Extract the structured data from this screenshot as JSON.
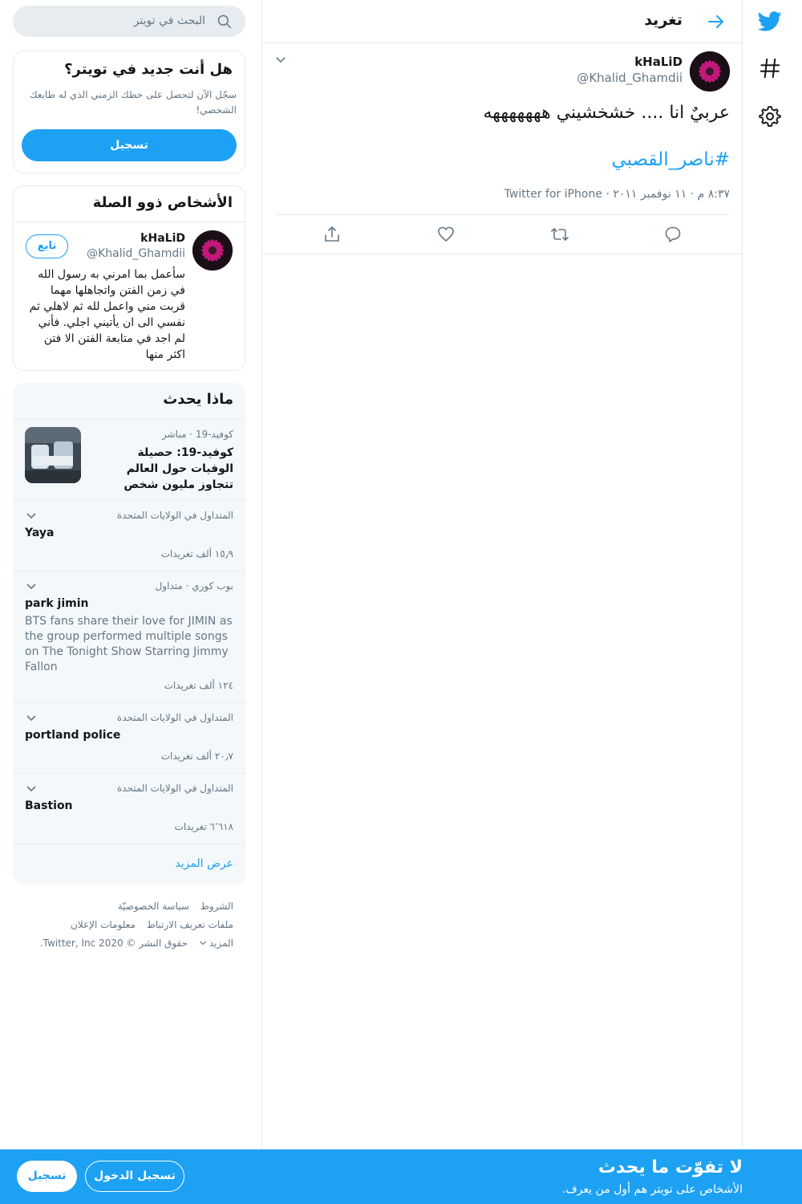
{
  "search": {
    "placeholder": "البحث في تويتر",
    "icon": "search-icon"
  },
  "new_to_twitter": {
    "title": "هل أنت جديد في تويتر؟",
    "description": "سجّل الآن لتحصل على خطك الزمني الذي له طابعك الشخصي!",
    "signup_label": "تسجيل"
  },
  "relevant_people": {
    "title": "الأشخاص ذوو الصلة",
    "user": {
      "name": "kHaLiD",
      "handle": "@Khalid_Ghamdii",
      "follow_label": "تابع",
      "bio": "سأعمل بما امرني به رسول الله في زمن الفتن واتجاهلها مهما قربت مني واعمل لله ثم لاهلي ثم نفسي الى ان يأتيني اجلي. فأني لم اجد في متابعة الفتن الا فتن اكثر منها"
    }
  },
  "trends": {
    "title": "ماذا يحدث",
    "news": {
      "meta": "كوفيد-19 · مباشر",
      "headline": "كوفيد-19: حصيلة الوفيات حول العالم تتجاوز مليون شخص"
    },
    "items": [
      {
        "meta": "المتداول في الولايات المتحدة",
        "name": "Yaya",
        "count": "١٥٫٩ ألف تغريدات"
      },
      {
        "meta": "بوب كوري · متداول",
        "name": "park jimin",
        "description": "BTS fans share their love for JIMIN as the group performed multiple songs on The Tonight Show Starring Jimmy Fallon",
        "count": "١٢٤ ألف تغريدات"
      },
      {
        "meta": "المتداول في الولايات المتحدة",
        "name": "portland police",
        "count": "٢٠٫٧ ألف تغريدات"
      },
      {
        "meta": "المتداول في الولايات المتحدة",
        "name": "Bastion",
        "count": "٦٬٦١٨ تغريدات"
      }
    ],
    "show_more": "عرض المزيد"
  },
  "footer": {
    "terms": "الشروط",
    "privacy": "سياسة الخصوصيّة",
    "cookies": "ملفات تعريف الارتباط",
    "ads_info": "معلومات الإعلان",
    "more": "المزيد",
    "copyright": "حقوق النشر © Twitter, Inc 2020."
  },
  "tweet_page": {
    "header_title": "تغريد",
    "tweet": {
      "name": "kHaLiD",
      "handle": "@Khalid_Ghamdii",
      "text": "عربيٌ انا .... خشخشيني هههههههه",
      "hashtag": "#ناصر_القصبي",
      "meta": "٨:٣٧ م · ١١ نوفمبر ٢٠١١ · Twitter for iPhone"
    }
  },
  "nav": {
    "icons": [
      "twitter-logo-icon",
      "hashtag-icon",
      "settings-gear-icon"
    ]
  },
  "banner": {
    "title": "لا تفوّت ما يحدث",
    "subtitle": "الأشخاص على تويتر هم أول من يعرف.",
    "login_label": "تسجيل الدخول",
    "signup_label": "تسجيل"
  },
  "colors": {
    "accent": "#1da1f2",
    "text": "#14171a",
    "muted": "#657786",
    "border": "#e6ecf0",
    "panel": "#f5f8fa"
  }
}
